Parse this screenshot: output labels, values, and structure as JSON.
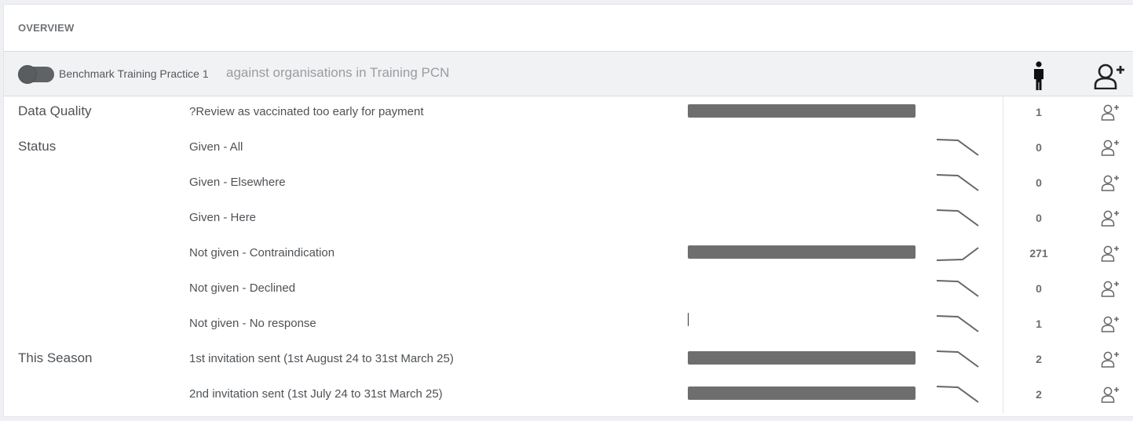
{
  "header": {
    "title": "OVERVIEW"
  },
  "benchmark": {
    "toggle_on": false,
    "practice": "Benchmark Training Practice 1",
    "against": "against organisations in Training PCN",
    "column_icons": [
      "person-icon",
      "add-person-icon"
    ]
  },
  "rows": [
    {
      "category": "Data Quality",
      "label": "?Review as vaccinated too early for payment",
      "bar_fraction": 1.0,
      "trend": null,
      "count": "1"
    },
    {
      "category": "Status",
      "label": "Given - All",
      "bar_fraction": 0,
      "trend": "down",
      "count": "0"
    },
    {
      "category": "",
      "label": "Given - Elsewhere",
      "bar_fraction": 0,
      "trend": "down",
      "count": "0"
    },
    {
      "category": "",
      "label": "Given - Here",
      "bar_fraction": 0,
      "trend": "down",
      "count": "0"
    },
    {
      "category": "",
      "label": "Not given - Contraindication",
      "bar_fraction": 1.0,
      "trend": "up",
      "count": "271"
    },
    {
      "category": "",
      "label": "Not given - Declined",
      "bar_fraction": 0,
      "trend": "down",
      "count": "0"
    },
    {
      "category": "",
      "label": "Not given - No response",
      "bar_fraction": 0.005,
      "trend": "down",
      "count": "1"
    },
    {
      "category": "This Season",
      "label": "1st invitation sent (1st August 24 to 31st March 25)",
      "bar_fraction": 1.0,
      "trend": "down",
      "count": "2"
    },
    {
      "category": "",
      "label": "2nd invitation sent (1st July 24 to 31st March 25)",
      "bar_fraction": 1.0,
      "trend": "down",
      "count": "2"
    }
  ],
  "colors": {
    "bar": "#6e6e6e",
    "spark": "#666666",
    "header_bg": "#f1f2f4"
  }
}
